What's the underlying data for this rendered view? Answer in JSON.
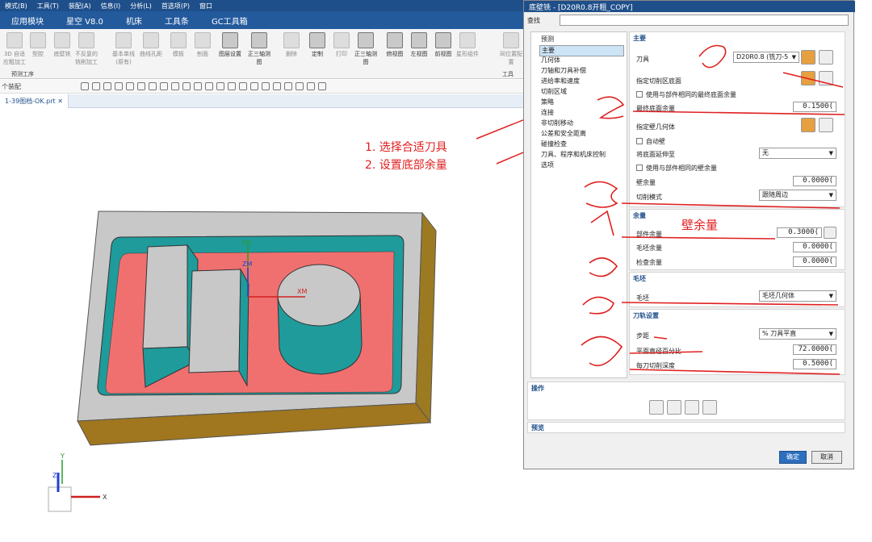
{
  "menubar": [
    "模式(B)",
    "工具(T)",
    "装配(A)",
    "信息(I)",
    "分析(L)",
    "首选项(P)",
    "窗口"
  ],
  "ribbon_tabs": [
    "应用模块",
    "星空 V8.0",
    "机床",
    "工具条",
    "GC工具箱"
  ],
  "ribbon_buttons": [
    {
      "label": "3D 自适应粗加工",
      "enabled": false
    },
    {
      "label": "型腔",
      "enabled": false
    },
    {
      "label": "底壁铣",
      "enabled": false
    },
    {
      "label": "不反复的铣削加工",
      "enabled": false
    },
    {
      "label": "基本单线(原有)",
      "enabled": false
    },
    {
      "label": "曲线孔距",
      "enabled": false
    },
    {
      "label": "模板",
      "enabled": false
    },
    {
      "label": "刨面",
      "enabled": false
    },
    {
      "label": "图层设置",
      "enabled": true
    },
    {
      "label": "正三轴测图",
      "enabled": true
    },
    {
      "label": "删除",
      "enabled": false
    },
    {
      "label": "定制",
      "enabled": true
    },
    {
      "label": "打印",
      "enabled": false
    },
    {
      "label": "正三轴测图",
      "enabled": true
    },
    {
      "label": "俯视图",
      "enabled": true
    },
    {
      "label": "左视图",
      "enabled": true
    },
    {
      "label": "前视图",
      "enabled": true
    },
    {
      "label": "星形组件",
      "enabled": false
    },
    {
      "label": "同位置配置",
      "enabled": false
    }
  ],
  "ribbon_groups": {
    "left": "预测工序",
    "right": "工具"
  },
  "toolbar_combo": "个装配",
  "file_tab": "1-39图档-OK.prt",
  "annotations": {
    "step1": "1.  选择合适刀具",
    "step2": "2.   设置底部余量",
    "wall": "壁余量"
  },
  "axes": {
    "ym": "YM",
    "zm": "ZM",
    "xm": "XM",
    "x": "X",
    "y": "Y",
    "z": "Z"
  },
  "dialog": {
    "title": "底壁铣 - [D20R0.8开粗_COPY]",
    "search_label": "查找",
    "nav": [
      "预测",
      "主要",
      "几何体",
      "刀轴和刀具补偿",
      "进给率和速度",
      "切削区域",
      "策略",
      "连接",
      "非切削移动",
      "公差和安全距离",
      "碰撞检查",
      "刀具、程序和机床控制",
      "选项"
    ],
    "nav_selected": 1,
    "main": {
      "header": "主要",
      "tool_label": "刀具",
      "tool_value": "D20R0.8 (铣刀-5",
      "floor_label": "指定切削区底面",
      "use_floor_stock": "使用与部件相同的最终底面余量",
      "final_floor_label": "最终底面余量",
      "final_floor_value": "0.1500(",
      "wall_geom_label": "指定壁几何体",
      "auto_wall": "自动壁",
      "extend_label": "将底面延伸至",
      "extend_value": "无",
      "use_wall_stock": "使用与部件相同的壁余量",
      "wall_stock_label": "壁余量",
      "wall_stock_value": "0.0000(",
      "cut_mode_label": "切削模式",
      "cut_mode_value": "跟随周边"
    },
    "stock": {
      "header": "余量",
      "part_label": "部件余量",
      "part_value": "0.3000(",
      "blank_label": "毛坯余量",
      "blank_value": "0.0000(",
      "check_label": "检查余量",
      "check_value": "0.0000("
    },
    "blank": {
      "header": "毛坯",
      "blank_label": "毛坯",
      "blank_value": "毛坯几何体"
    },
    "path": {
      "header": "刀轨设置",
      "step_label": "步距",
      "step_value": "% 刀具平直",
      "pct_label": "平面直径百分比",
      "pct_value": "72.0000(",
      "depth_label": "每刀切削深度",
      "depth_value": "0.5000("
    },
    "ops_header": "操作",
    "preview_header": "预览",
    "ok": "确定",
    "cancel": "取消"
  },
  "colors": {
    "accent": "#1f4f8a",
    "floor": "#f07070",
    "wall": "#1f9b9b",
    "body": "#c8c8c8",
    "side": "#9b7a22",
    "annotation": "#e02020"
  }
}
